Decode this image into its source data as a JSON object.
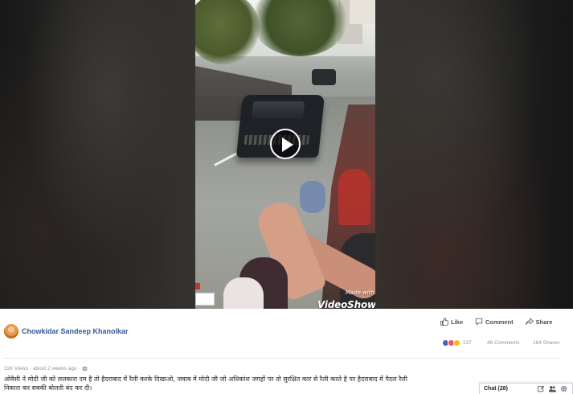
{
  "video": {
    "watermark_small": "Made with",
    "watermark_big": "VideoShow",
    "play_button_label": "Play video"
  },
  "post": {
    "author": "Chowkidar Sandeep Khanolkar",
    "actions": {
      "like": "Like",
      "comment": "Comment",
      "share": "Share"
    },
    "stats": {
      "reactions_count": "237",
      "comments": "46 Comments",
      "shares": "164 Shares"
    },
    "meta": "11K Views · about 2 weeks ago ·",
    "caption": "ओवैसी ने मोदी जी को ललकारा दम है तो हैदराबाद में रैली करके दिखाओ, जवाब में मोदी जी जो अधिकांश जगहों पर तो सुरक्षित कार से रैली करते है पर हैदराबाद में पैदल रैली निकाल कर सबकी बोलती बंद कर दी।"
  },
  "chat": {
    "label": "Chat (28)"
  },
  "colors": {
    "link_blue": "#365899",
    "like_blue": "#4267b2",
    "love_red": "#f25268",
    "haha_yellow": "#f7b928"
  },
  "icons": [
    "play-icon",
    "like-icon",
    "comment-icon",
    "share-icon",
    "globe-icon",
    "compose-icon",
    "people-icon",
    "gear-icon"
  ]
}
